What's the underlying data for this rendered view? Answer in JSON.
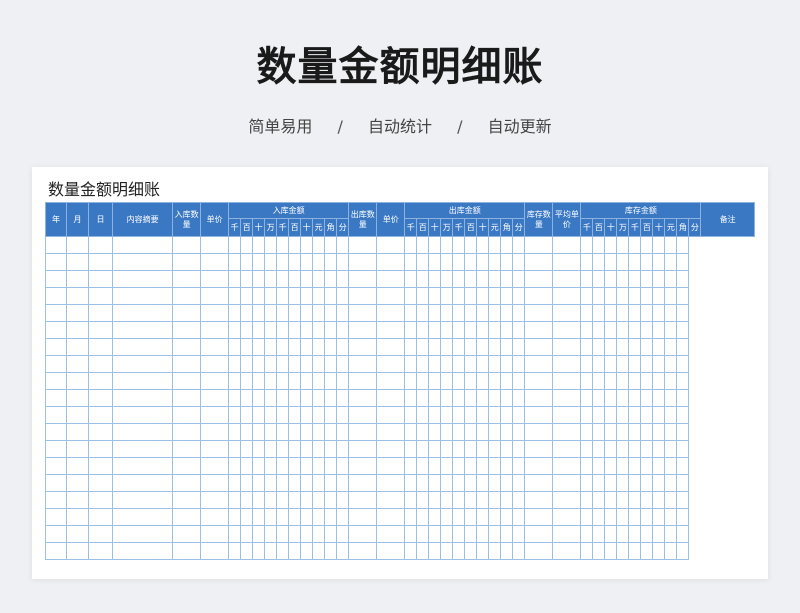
{
  "page": {
    "title": "数量金额明细账",
    "tags": [
      "简单易用",
      "自动统计",
      "自动更新"
    ],
    "separator": "/"
  },
  "sheet": {
    "title": "数量金额明细账",
    "columns": {
      "year": "年",
      "month": "月",
      "day": "日",
      "summary": "内容摘要",
      "in_qty": "入库数量",
      "in_price": "单价",
      "in_amount": "入库金额",
      "out_qty": "出库数量",
      "out_price": "单价",
      "out_amount": "出库金额",
      "stock_qty": "库存数量",
      "avg_price": "平均单价",
      "stock_amount": "库存金额",
      "remark": "备注"
    },
    "digit_units": [
      "千",
      "百",
      "十",
      "万",
      "千",
      "百",
      "十",
      "元",
      "角",
      "分"
    ],
    "row_count": 19
  }
}
